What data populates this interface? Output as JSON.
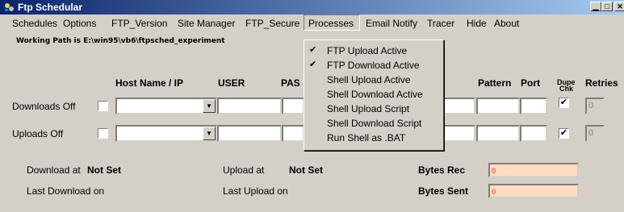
{
  "window": {
    "title": "Ftp Schedular",
    "icon": "ftp-app-icon"
  },
  "menubar": {
    "items": [
      "Schedules",
      "Options",
      "FTP_Version",
      "Site Manager",
      "FTP_Secure",
      "Processes",
      "Email Notify",
      "Tracer",
      "Hide",
      "About"
    ],
    "open_item": "Processes"
  },
  "working_path": "Working Path is E:\\win95\\vb6\\ftpsched_experiment",
  "headers": {
    "host": "Host Name / IP",
    "user": "USER",
    "pass": "PAS",
    "pattern": "Pattern",
    "port": "Port",
    "dupe_line1": "Dupe",
    "dupe_line2": "Chk",
    "retries": "Retries"
  },
  "rows": {
    "downloads": {
      "label": "Downloads Off",
      "checked": false,
      "dupe_checked": true,
      "retries": "0"
    },
    "uploads": {
      "label": "Uploads Off",
      "checked": false,
      "dupe_checked": true,
      "retries": "0"
    }
  },
  "status": {
    "download_at_label": "Download at",
    "download_at_value": "Not Set",
    "upload_at_label": "Upload at",
    "upload_at_value": "Not Set",
    "last_download_label": "Last Download on",
    "last_upload_label": "Last Upload on",
    "bytes_rec_label": "Bytes Rec",
    "bytes_rec_value": "0",
    "bytes_sent_label": "Bytes Sent",
    "bytes_sent_value": "0"
  },
  "processes_menu": [
    {
      "label": "FTP Upload Active",
      "checked": true
    },
    {
      "label": "FTP Download Active",
      "checked": true
    },
    {
      "label": "Shell Upload Active",
      "checked": false
    },
    {
      "label": "Shell Download Active",
      "checked": false
    },
    {
      "label": "Shell Upload Script",
      "checked": false
    },
    {
      "label": "Shell Download Script",
      "checked": false
    },
    {
      "label": "Run Shell as .BAT",
      "checked": false
    }
  ],
  "colors": {
    "titlebar_start": "#0a246a",
    "titlebar_end": "#a6caf0",
    "bytes_field_bg": "#fedcc2",
    "bytes_field_text": "#e03000"
  }
}
